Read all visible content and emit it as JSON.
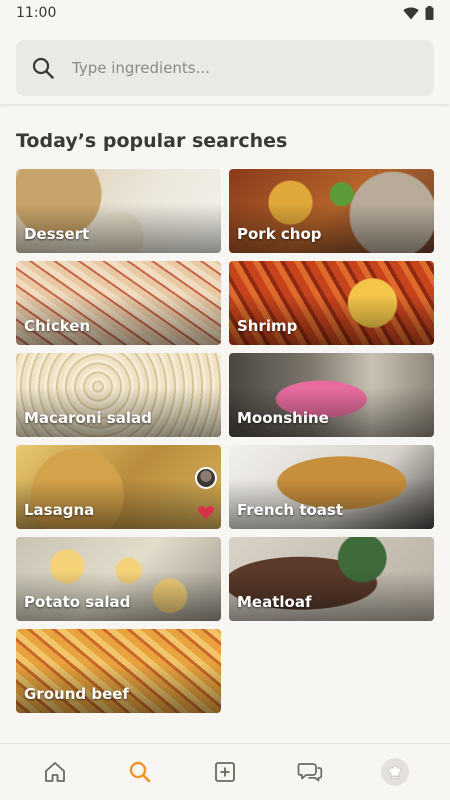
{
  "status_bar": {
    "time": "11:00"
  },
  "search": {
    "placeholder": "Type ingredients..."
  },
  "section": {
    "title": "Today’s popular searches"
  },
  "popular_searches": [
    {
      "label": "Dessert"
    },
    {
      "label": "Pork chop"
    },
    {
      "label": "Chicken"
    },
    {
      "label": "Shrimp"
    },
    {
      "label": "Macaroni salad"
    },
    {
      "label": "Moonshine"
    },
    {
      "label": "Lasagna"
    },
    {
      "label": "French toast"
    },
    {
      "label": "Potato salad"
    },
    {
      "label": "Meatloaf"
    },
    {
      "label": "Ground beef"
    }
  ],
  "bottom_nav": {
    "items": [
      "home-icon",
      "search-icon",
      "add-icon",
      "chat-icon",
      "profile-avatar"
    ],
    "active": "search-icon"
  },
  "colors": {
    "accent": "#f0932b",
    "background": "#f8f6f2",
    "icon": "#6b6862"
  }
}
